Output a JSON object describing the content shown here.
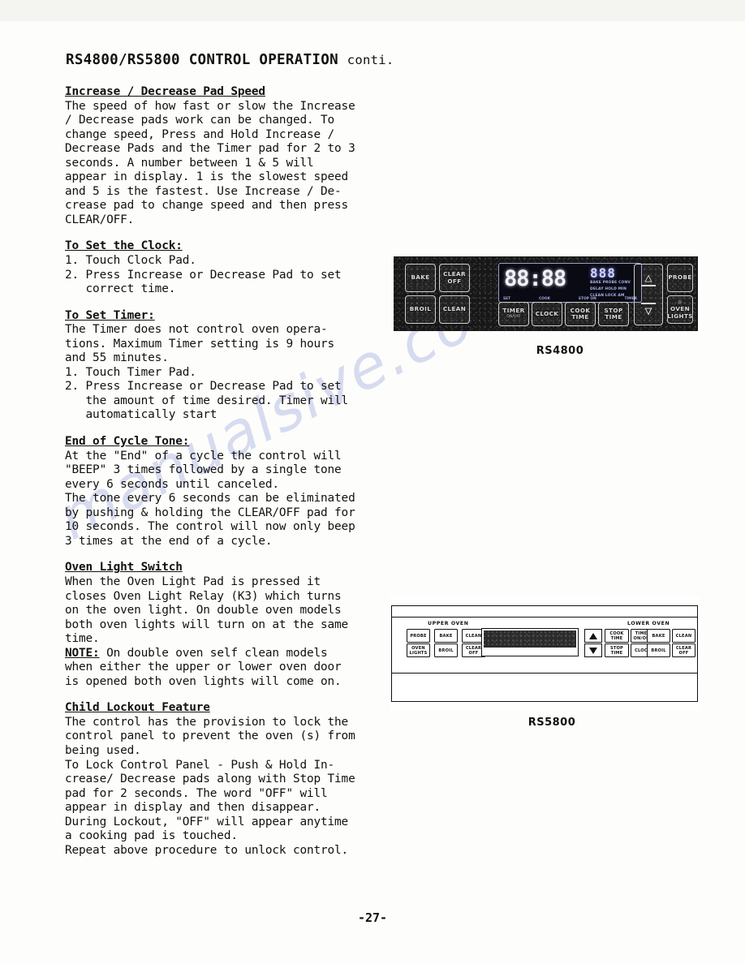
{
  "page": {
    "title_main": "RS4800/RS5800 CONTROL OPERATION",
    "title_cont": "conti.",
    "page_number": "-27-",
    "watermark": "manualsive.co"
  },
  "sections": [
    {
      "heading": "Increase / Decrease Pad Speed",
      "body": "The speed of how fast or slow the Increase\n/ Decrease pads work can be changed. To\nchange speed, Press and Hold Increase /\nDecrease Pads and the Timer pad for 2 to 3\nseconds. A number between 1 & 5 will\nappear in display. 1 is the slowest speed\nand 5 is the fastest. Use Increase / De-\ncrease pad to change speed and then press\nCLEAR/OFF."
    },
    {
      "heading": "To Set the Clock:",
      "body": "1. Touch Clock Pad.\n2. Press Increase or Decrease Pad to set\n   correct time."
    },
    {
      "heading": "To Set Timer:",
      "body": "The Timer does not control oven opera-\ntions. Maximum Timer setting is 9 hours\nand 55 minutes.\n1. Touch Timer Pad.\n2. Press Increase or Decrease Pad to set\n   the amount of time desired. Timer will\n   automatically start"
    },
    {
      "heading": "End of Cycle Tone:",
      "body": "At the \"End\" of a cycle the control will\n\"BEEP\" 3 times followed by a single tone\nevery 6 seconds until canceled.\nThe tone every 6 seconds can be eliminated\nby pushing & holding the CLEAR/OFF pad for\n10 seconds. The control will now only beep\n3 times at the end of a cycle."
    },
    {
      "heading": "Oven Light Switch",
      "body_before_note": "When the Oven Light Pad is pressed it\ncloses Oven Light Relay (K3) which turns\non the oven light. On double oven models\nboth oven lights will turn on at the same\ntime.\n",
      "note_label": "NOTE:",
      "body_after_note": " On double oven self clean models\nwhen either the upper or lower oven door\nis opened both oven lights will come on."
    },
    {
      "heading": "Child Lockout Feature",
      "body": "The control has the provision to lock the\ncontrol panel to prevent the oven (s) from\nbeing used.\nTo Lock Control Panel - Push & Hold In-\ncrease/ Decrease pads along with Stop Time\npad for 2 seconds. The word \"OFF\" will\nappear in display and then disappear.\nDuring Lockout, \"OFF\" will appear anytime\na cooking pad is touched.\nRepeat above procedure to unlock control."
    }
  ],
  "rs4800": {
    "caption": "RS4800",
    "pads": [
      {
        "label": "BAKE",
        "sub": ""
      },
      {
        "label": "CLEAR OFF",
        "sub": ""
      },
      {
        "label": "BROIL",
        "sub": ""
      },
      {
        "label": "CLEAN",
        "sub": ""
      },
      {
        "label": "TIMER",
        "sub": "ON/OFF"
      },
      {
        "label": "CLOCK",
        "sub": ""
      },
      {
        "label": "COOK TIME",
        "sub": ""
      },
      {
        "label": "STOP TIME",
        "sub": ""
      },
      {
        "label": "PROBE",
        "sub": ""
      },
      {
        "label": "OVEN LIGHTS",
        "sub": ""
      }
    ],
    "display": {
      "time": "88:88",
      "temp": "888",
      "annunciators_row1": [
        "BAKE",
        "PROBE",
        "CONV"
      ],
      "annunciators_row2": [
        "DELAY",
        "HOLD",
        "MIN"
      ],
      "annunciators_row3": [
        "CLEAN",
        "LOCK",
        "AM"
      ],
      "bottom_labels": [
        "SET",
        "COOK",
        "STOP ON",
        "TIMER"
      ]
    },
    "arrow_up_icon": "increase-arrow",
    "arrow_down_icon": "decrease-arrow"
  },
  "rs5800": {
    "caption": "RS5800",
    "upper_oven_label": "UPPER OVEN",
    "lower_oven_label": "LOWER OVEN",
    "upper_pads": [
      {
        "label": "PROBE"
      },
      {
        "label": "BAKE"
      },
      {
        "label": "CLEAN"
      },
      {
        "label": "OVEN LIGHTS"
      },
      {
        "label": "BROIL"
      },
      {
        "label": "CLEAR OFF"
      }
    ],
    "center_pads": [
      {
        "label": "COOK TIME"
      },
      {
        "label": "TIMER ON/OFF"
      },
      {
        "label": "STOP TIME"
      },
      {
        "label": "CLOCK"
      }
    ],
    "lower_pads": [
      {
        "label": "BAKE"
      },
      {
        "label": "CLEAN"
      },
      {
        "label": "BROIL"
      },
      {
        "label": "CLEAR OFF"
      }
    ]
  }
}
